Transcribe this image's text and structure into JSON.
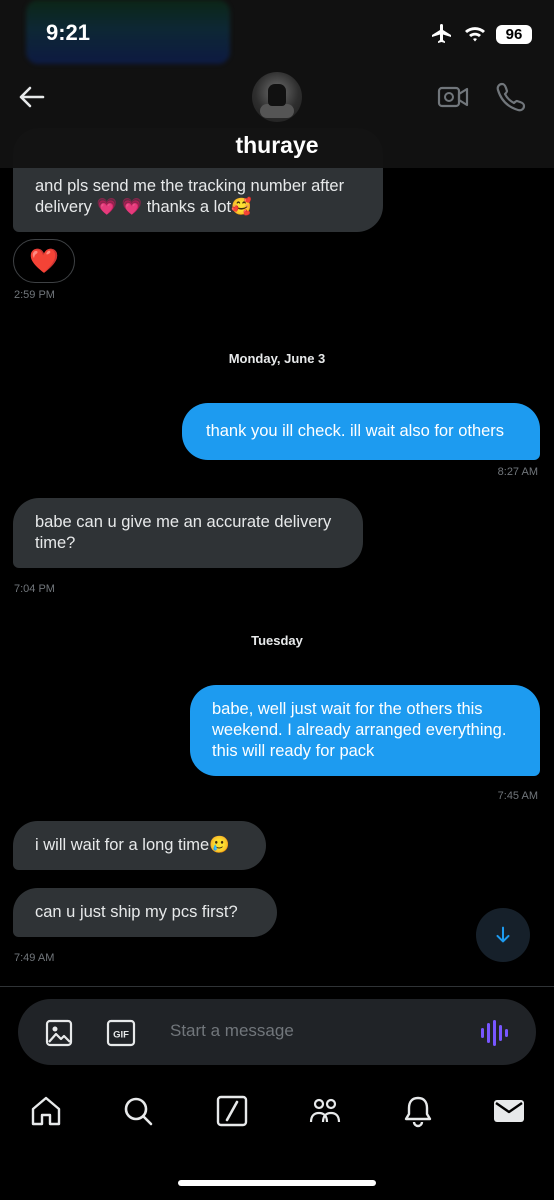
{
  "status_bar": {
    "time": "9:21",
    "battery": "96"
  },
  "header": {
    "contact_name": "thuraye"
  },
  "messages": [
    {
      "id": "m1",
      "text": "and pls send me the tracking number after delivery 💗 💗 thanks a lot🥰",
      "reaction": "❤️",
      "time": "2:59 PM"
    },
    {
      "id": "day1",
      "label": "Monday, June 3"
    },
    {
      "id": "m2",
      "text": "thank you ill check. ill wait also for others",
      "time": "8:27 AM"
    },
    {
      "id": "m3",
      "text": "babe can u give me an accurate delivery time?",
      "time": "7:04 PM"
    },
    {
      "id": "day2",
      "label": "Tuesday"
    },
    {
      "id": "m4",
      "text": "babe, well just wait for the others this weekend. I already arranged everything. this will ready for pack",
      "time": "7:45 AM"
    },
    {
      "id": "m5",
      "text": "i will wait for a long time🥲"
    },
    {
      "id": "m6",
      "text": "can u just ship my pcs first?",
      "time": "7:49 AM"
    }
  ],
  "composer": {
    "placeholder": "Start a message",
    "gif_label": "GIF"
  },
  "nav": [
    "home-icon",
    "search-icon",
    "grok-icon",
    "communities-icon",
    "notifications-icon",
    "messages-icon"
  ],
  "colors": {
    "outgoing": "#1d9bf0",
    "incoming": "#2f3336",
    "background": "#000000",
    "voice_accent": "#7856ff"
  }
}
